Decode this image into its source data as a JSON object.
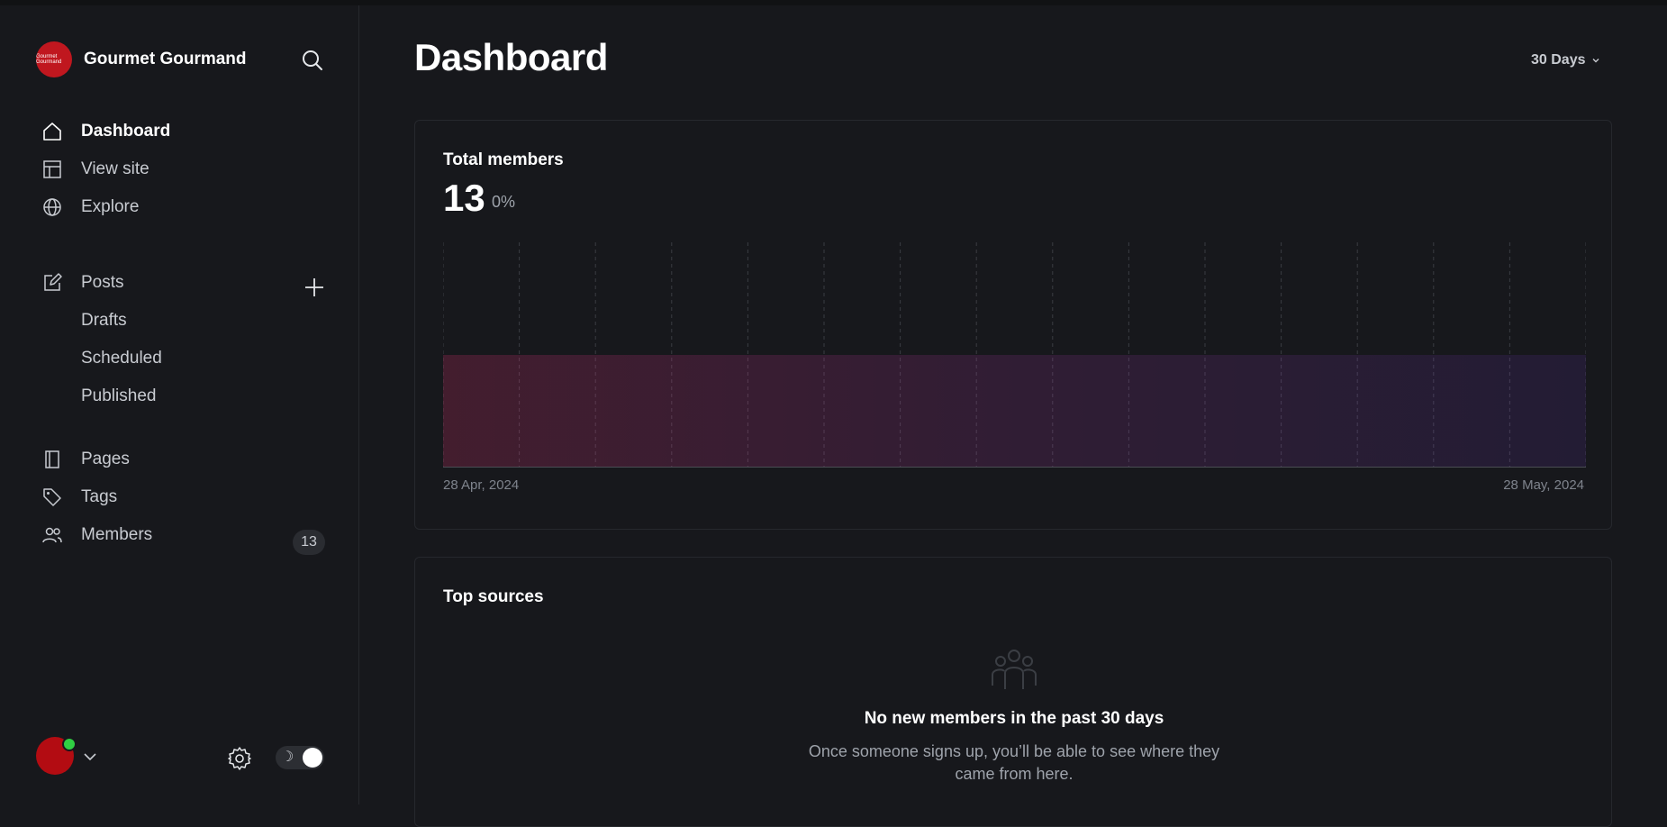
{
  "brand": {
    "name": "Gourmet Gourmand",
    "logo_text": "Gourmet Gourmand"
  },
  "nav": {
    "dashboard": "Dashboard",
    "view_site": "View site",
    "explore": "Explore",
    "posts": "Posts",
    "drafts": "Drafts",
    "scheduled": "Scheduled",
    "published": "Published",
    "pages": "Pages",
    "tags": "Tags",
    "members": "Members",
    "members_count": "13"
  },
  "header": {
    "title": "Dashboard",
    "range": "30 Days"
  },
  "members_card": {
    "title": "Total members",
    "total": "13",
    "change": "0%",
    "date_start": "28 Apr, 2024",
    "date_end": "28 May, 2024"
  },
  "sources_card": {
    "title": "Top sources",
    "empty_title": "No new members in the past 30 days",
    "empty_desc": "Once someone signs up, you’ll be able to see where they came from here."
  },
  "footer": {
    "theme_icon": "☽"
  },
  "colors": {
    "line_start": "#f0307a",
    "line_end": "#8d3cf5",
    "online": "#30cf43"
  },
  "chart_data": {
    "type": "area",
    "x_start": "28 Apr, 2024",
    "x_end": "28 May, 2024",
    "values": [
      13,
      13,
      13,
      13,
      13,
      13,
      13,
      13,
      13,
      13,
      13,
      13,
      13,
      13,
      13,
      13
    ],
    "ylim": [
      0,
      26
    ]
  }
}
